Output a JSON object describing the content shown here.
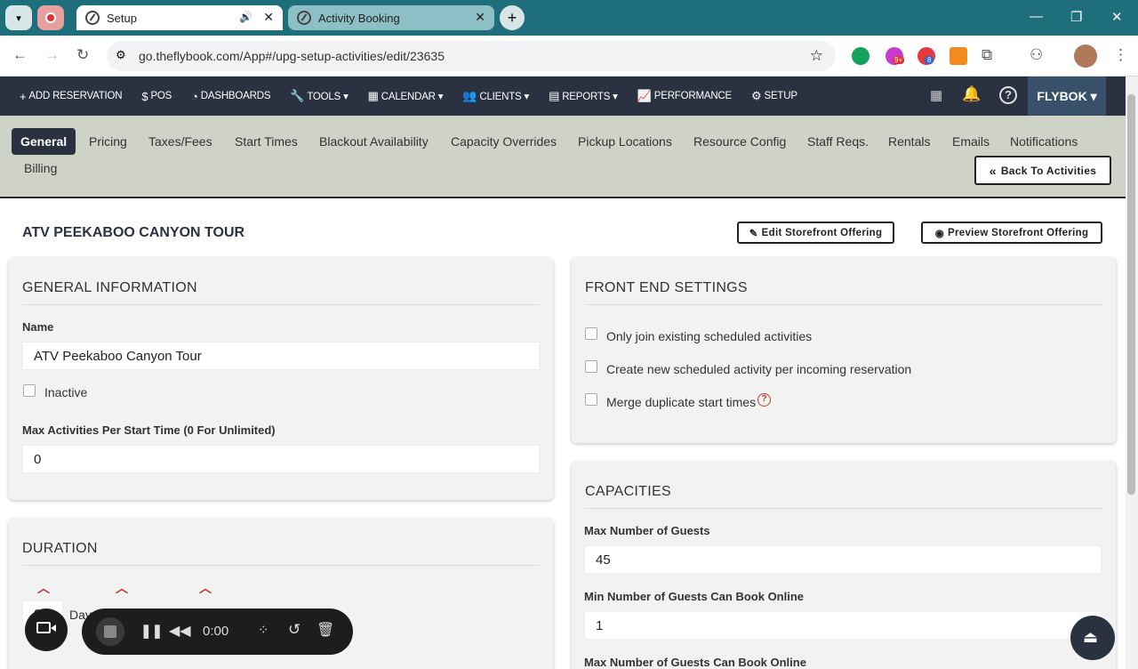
{
  "browser": {
    "tabs": [
      {
        "label": "Setup",
        "active": true
      },
      {
        "label": "Activity Booking",
        "active": false
      }
    ],
    "url": "go.theflybook.com/App#/upg-setup-activities/edit/23635",
    "ext_badge_1": "9+",
    "ext_badge_2": "8"
  },
  "nav": {
    "items": [
      {
        "label": "ADD RESERVATION",
        "icon": "+"
      },
      {
        "label": "POS",
        "icon": "$"
      },
      {
        "label": "DASHBOARDS",
        "icon": "◔"
      },
      {
        "label": "TOOLS ▾",
        "icon": "🔧"
      },
      {
        "label": "CALENDAR ▾",
        "icon": "▦"
      },
      {
        "label": "CLIENTS ▾",
        "icon": "👥"
      },
      {
        "label": "REPORTS ▾",
        "icon": "▤"
      },
      {
        "label": "PERFORMANCE",
        "icon": "📈"
      },
      {
        "label": "SETUP",
        "icon": "⚙"
      }
    ],
    "account": "FLYBOK ▾"
  },
  "subtabs": [
    "General",
    "Pricing",
    "Taxes/Fees",
    "Start Times",
    "Blackout Availability",
    "Capacity Overrides",
    "Pickup Locations",
    "Resource Config",
    "Staff Reqs.",
    "Rentals",
    "Emails",
    "Notifications",
    "Billing"
  ],
  "back_button": "Back To Activities",
  "page": {
    "title": "ATV PEEKABOO CANYON TOUR",
    "edit_storefront": "Edit Storefront Offering",
    "preview_storefront": "Preview Storefront Offering"
  },
  "general": {
    "heading": "GENERAL INFORMATION",
    "name_label": "Name",
    "name_value": "ATV Peekaboo Canyon Tour",
    "inactive_label": "Inactive",
    "max_label": "Max Activities Per Start Time (0 For Unlimited)",
    "max_value": "0"
  },
  "duration": {
    "heading": "DURATION",
    "days_label": "Days",
    "days_value": "0"
  },
  "frontend": {
    "heading": "FRONT END SETTINGS",
    "options": [
      "Only join existing scheduled activities",
      "Create new scheduled activity per incoming reservation",
      "Merge duplicate start times"
    ]
  },
  "capacities": {
    "heading": "CAPACITIES",
    "max_guests_label": "Max Number of Guests",
    "max_guests_value": "45",
    "min_online_label": "Min Number of Guests Can Book Online",
    "min_online_value": "1",
    "max_online_label": "Max Number of Guests Can Book Online"
  },
  "recorder": {
    "time": "0:00"
  }
}
